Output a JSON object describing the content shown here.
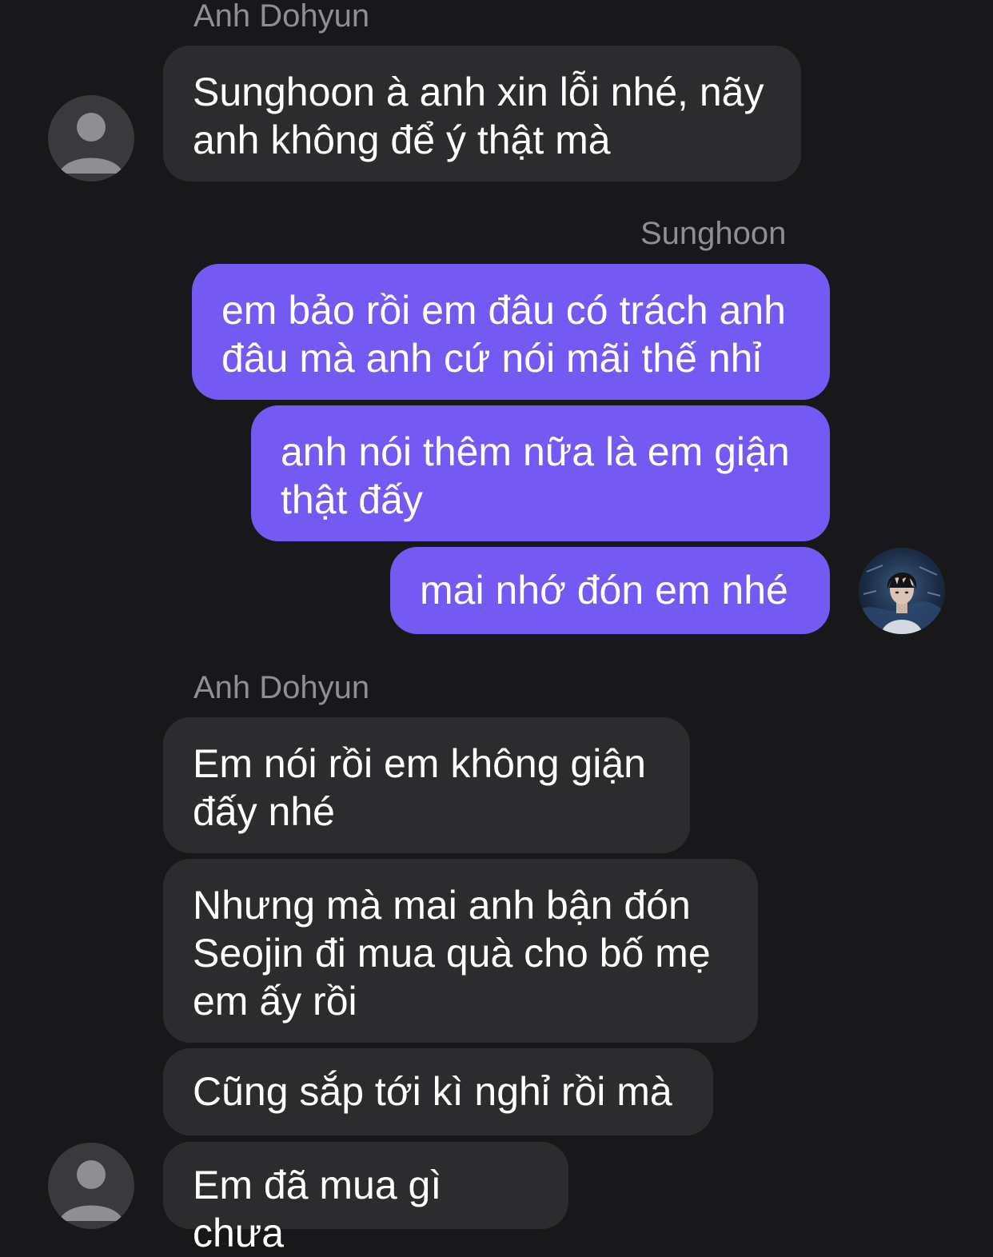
{
  "conversation": {
    "groups": [
      {
        "sender": "Anh Dohyun",
        "messages": [
          "Sunghoon à anh xin lỗi nhé, nãy\nanh không để ý thật mà"
        ]
      },
      {
        "sender": "Sunghoon",
        "messages": [
          "em bảo rồi em đâu có trách anh\nđâu mà anh cứ nói mãi thế nhỉ",
          "anh nói thêm nữa là em giận\nthật đấy",
          "mai nhớ đón em nhé"
        ]
      },
      {
        "sender": "Anh Dohyun",
        "messages": [
          "Em nói rồi em không giận\nđấy nhé",
          "Nhưng mà mai anh bận đón\nSeojin đi mua quà cho bố mẹ\nem ấy rồi",
          "Cũng sắp tới kì nghỉ rồi mà",
          "Em đã mua gì chưa"
        ]
      }
    ]
  },
  "colors": {
    "background": "#18181a",
    "incoming_bubble": "#2c2c2e",
    "outgoing_bubble": "#7459f2",
    "sender_name": "#8e8e93",
    "message_text": "#ffffff"
  },
  "icons": {
    "incoming_avatar": "person-silhouette-icon",
    "outgoing_avatar": "profile-photo"
  }
}
